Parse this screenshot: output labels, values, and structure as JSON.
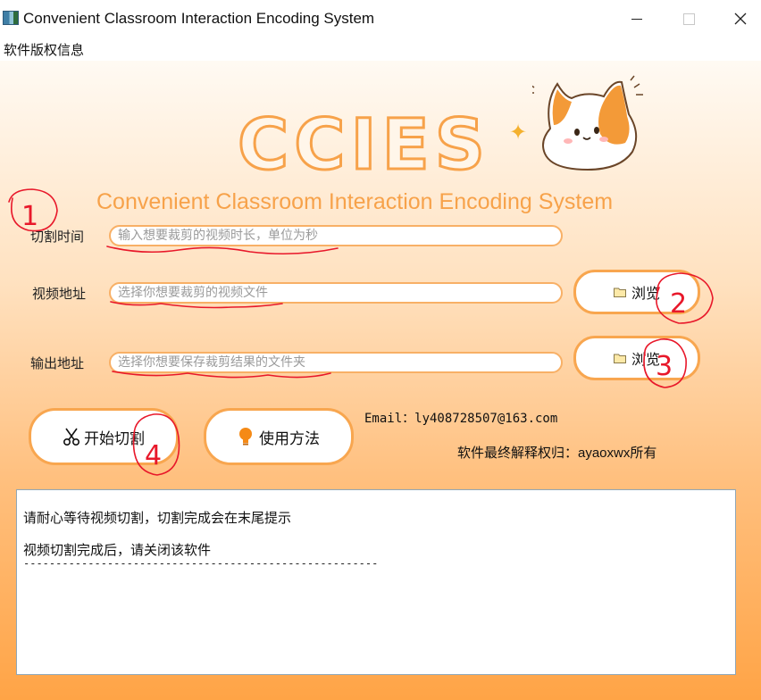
{
  "window": {
    "title": "Convenient Classroom Interaction Encoding System"
  },
  "menu": {
    "items": [
      "软件版权信息"
    ]
  },
  "header": {
    "logo_text": "CCIES",
    "subtitle": "Convenient Classroom Interaction Encoding System",
    "mascot": "corgi-cat-icon",
    "sparkle": "✦"
  },
  "form": {
    "cut_time": {
      "label": "切割时间",
      "placeholder": "输入想要裁剪的视频时长，单位为秒",
      "value": ""
    },
    "video_path": {
      "label": "视频地址",
      "placeholder": "选择你想要裁剪的视频文件",
      "value": ""
    },
    "output_path": {
      "label": "输出地址",
      "placeholder": "选择你想要保存裁剪结果的文件夹",
      "value": ""
    },
    "browse_label": "浏览"
  },
  "actions": {
    "start_label": "开始切割",
    "help_label": "使用方法"
  },
  "info": {
    "email": "Email：ly408728507@163.com",
    "copyright": "软件最终解释权归：ayaoxwx所有"
  },
  "log": {
    "lines": [
      "请耐心等待视频切割，切割完成会在末尾提示",
      "视频切割完成后，请关闭该软件",
      "-------------------------------------------------------"
    ]
  },
  "annotations": {
    "numbers": [
      "1",
      "2",
      "3",
      "4"
    ],
    "color": "#e8182a"
  },
  "colors": {
    "accent": "#f8a64f",
    "gradient_top": "#fffaf3",
    "gradient_bottom": "#ffa446"
  }
}
